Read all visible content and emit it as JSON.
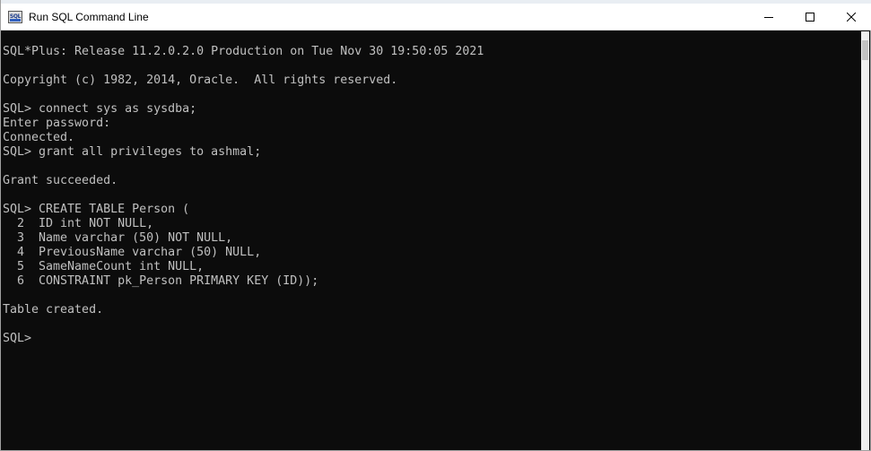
{
  "window": {
    "title": "Run SQL Command Line",
    "app_icon_text": "SQL",
    "controls": {
      "minimize_icon": "minimize-icon",
      "maximize_icon": "maximize-icon",
      "close_icon": "close-icon"
    }
  },
  "console": {
    "background": "#0c0c0c",
    "foreground": "#c0c0c0",
    "lines": [
      "SQL*Plus: Release 11.2.0.2.0 Production on Tue Nov 30 19:50:05 2021",
      "",
      "Copyright (c) 1982, 2014, Oracle.  All rights reserved.",
      "",
      "SQL> connect sys as sysdba;",
      "Enter password:",
      "Connected.",
      "SQL> grant all privileges to ashmal;",
      "",
      "Grant succeeded.",
      "",
      "SQL> CREATE TABLE Person (",
      "  2  ID int NOT NULL,",
      "  3  Name varchar (50) NOT NULL,",
      "  4  PreviousName varchar (50) NULL,",
      "  5  SameNameCount int NULL,",
      "  6  CONSTRAINT pk_Person PRIMARY KEY (ID));",
      "",
      "Table created.",
      "",
      "SQL>"
    ]
  }
}
